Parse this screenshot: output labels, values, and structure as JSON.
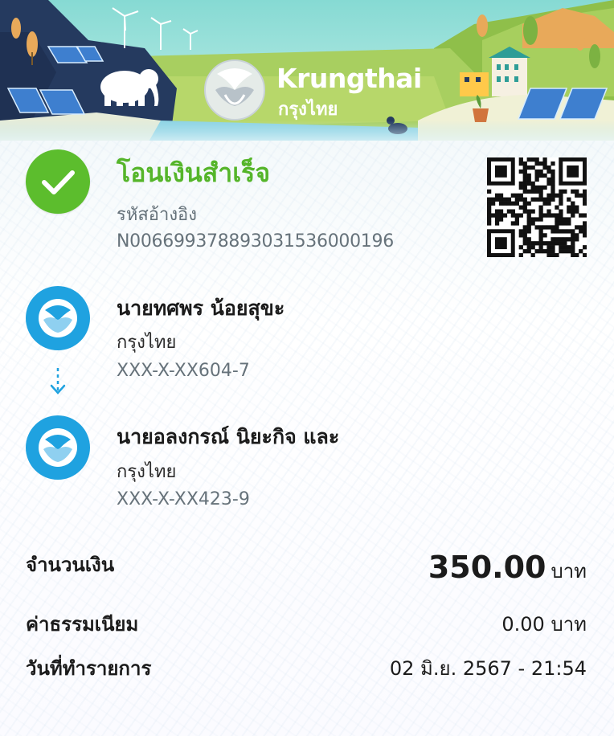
{
  "brand": {
    "name_en": "Krungthai",
    "name_th": "กรุงไทย"
  },
  "colors": {
    "success_green": "#5cbd2d",
    "bank_blue": "#1fa2e0",
    "muted_text": "#66727a"
  },
  "status": {
    "icon": "check-icon",
    "title": "โอนเงินสำเร็จ",
    "reference_label": "รหัสอ้างอิง",
    "reference_code": "N006699378893031536000196"
  },
  "qr": {
    "icon": "qr-code-icon"
  },
  "sender": {
    "name": "นายทศพร น้อยสุขะ",
    "bank": "กรุงไทย",
    "account": "XXX-X-XX604-7"
  },
  "receiver": {
    "name": "นายอลงกรณ์ นิยะกิจ และ",
    "bank": "กรุงไทย",
    "account": "XXX-X-XX423-9"
  },
  "details": {
    "amount_label": "จำนวนเงิน",
    "amount_value": "350.00",
    "amount_unit": "บาท",
    "fee_label": "ค่าธรรมเนียม",
    "fee_value": "0.00 บาท",
    "date_label": "วันที่ทำรายการ",
    "date_value": "02 มิ.ย. 2567 - 21:54"
  }
}
